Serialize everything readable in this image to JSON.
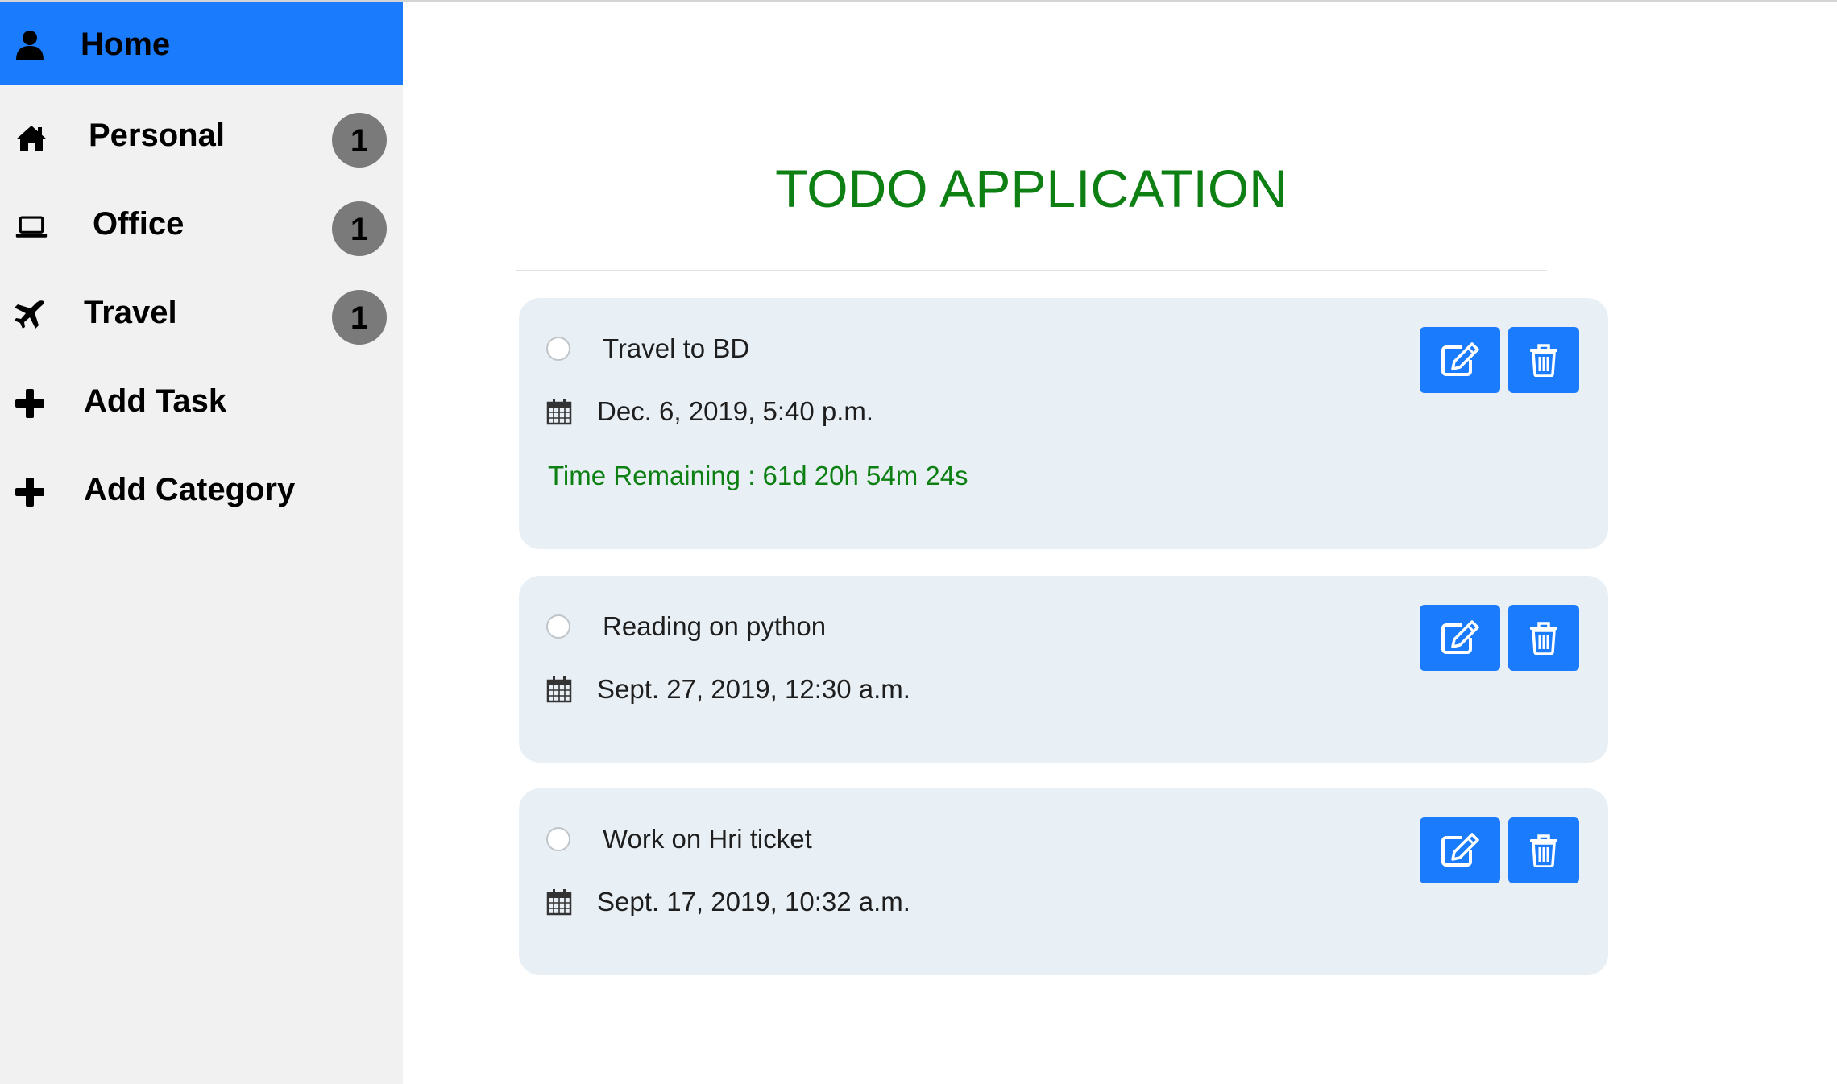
{
  "sidebar": {
    "items": [
      {
        "label": "Home",
        "icon": "user-icon",
        "active": true
      },
      {
        "label": "Personal",
        "icon": "home-icon",
        "badge": "1"
      },
      {
        "label": "Office",
        "icon": "laptop-icon",
        "badge": "1"
      },
      {
        "label": "Travel",
        "icon": "plane-icon",
        "badge": "1"
      },
      {
        "label": "Add Task",
        "icon": "plus-icon"
      },
      {
        "label": "Add Category",
        "icon": "plus-icon"
      }
    ]
  },
  "main": {
    "title": "TODO APPLICATION",
    "tasks": [
      {
        "title": "Travel to BD",
        "date": "Dec. 6, 2019, 5:40 p.m.",
        "remaining": "Time Remaining : 61d 20h 54m 24s"
      },
      {
        "title": "Reading on python",
        "date": "Sept. 27, 2019, 12:30 a.m."
      },
      {
        "title": "Work on Hri ticket",
        "date": "Sept. 17, 2019, 10:32 a.m."
      }
    ]
  },
  "colors": {
    "accent": "#1a7bfc",
    "title_green": "#0e8013",
    "sidebar_bg": "#f1f1f1",
    "card_bg": "#e8f0f6",
    "badge_bg": "#7a7a7a"
  }
}
